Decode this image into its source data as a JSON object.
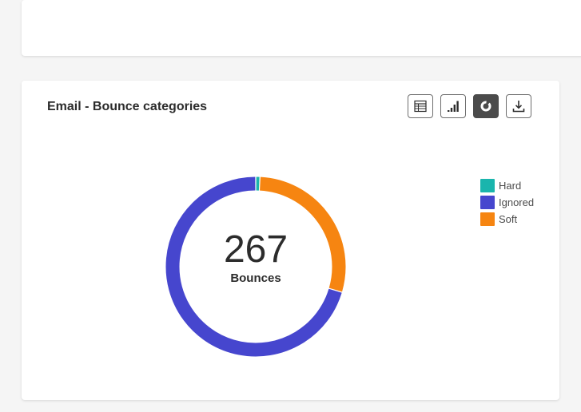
{
  "card": {
    "title": "Email - Bounce categories"
  },
  "toolbar": {
    "buttons": [
      {
        "name": "table-view",
        "icon": "table-icon",
        "active": false
      },
      {
        "name": "bar-view",
        "icon": "bar-chart-icon",
        "active": false
      },
      {
        "name": "donut-view",
        "icon": "donut-chart-icon",
        "active": true
      },
      {
        "name": "download",
        "icon": "download-icon",
        "active": false
      }
    ]
  },
  "center": {
    "value": "267",
    "label": "Bounces"
  },
  "legend": [
    {
      "label": "Hard",
      "color": "#1ab5ad"
    },
    {
      "label": "Ignored",
      "color": "#4646ce"
    },
    {
      "label": "Soft",
      "color": "#f68511"
    }
  ],
  "chart_data": {
    "type": "pie",
    "title": "Email - Bounce categories",
    "total": 267,
    "series": [
      {
        "name": "Hard",
        "value": 2,
        "color": "#1ab5ad"
      },
      {
        "name": "Soft",
        "value": 77,
        "color": "#f68511"
      },
      {
        "name": "Ignored",
        "value": 188,
        "color": "#4646ce"
      }
    ]
  }
}
